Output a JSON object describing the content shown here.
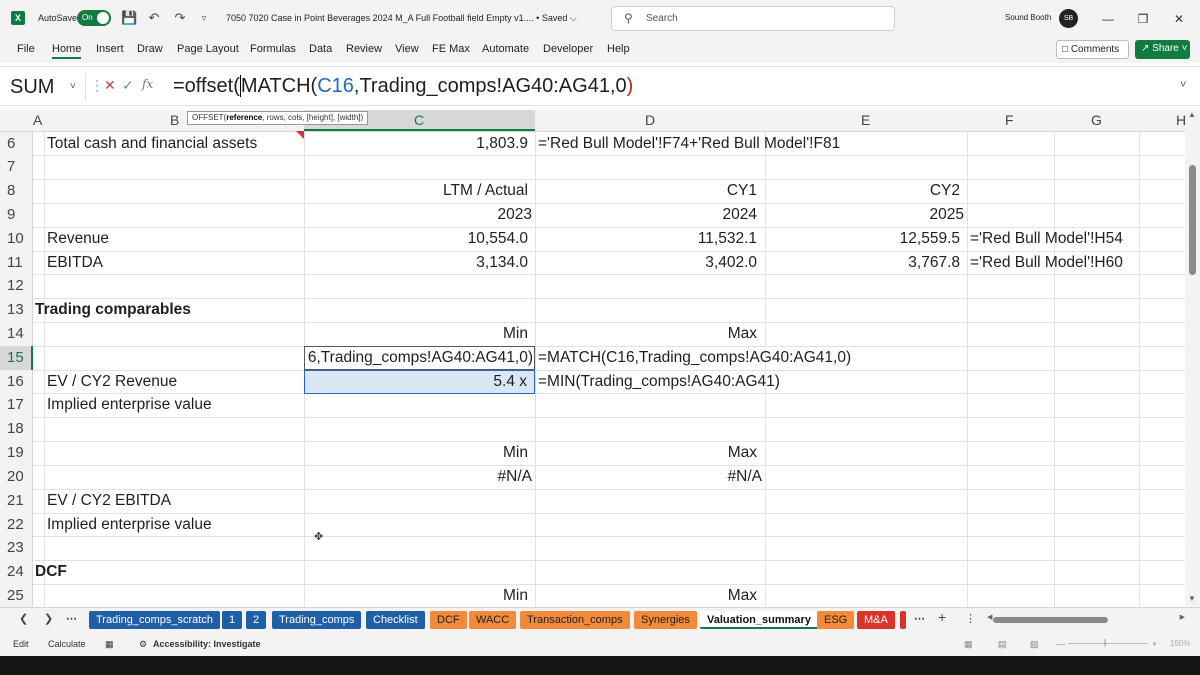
{
  "titlebar": {
    "autosave_label": "AutoSave",
    "autosave_state": "On",
    "doc_title": "7050 7020 Case in Point Beverages 2024 M_A Full Football field Empty v1.... • Saved ⌵",
    "search_placeholder": "Search",
    "user_name": "Sound Booth",
    "avatar_initials": "SB",
    "icons": [
      "excel-logo",
      "save-icon",
      "undo-icon",
      "redo-icon",
      "customize-icon",
      "search-icon",
      "minimize-icon",
      "restore-icon",
      "close-icon"
    ]
  },
  "ribbon": {
    "tabs": [
      "File",
      "Home",
      "Insert",
      "Draw",
      "Page Layout",
      "Formulas",
      "Data",
      "Review",
      "View",
      "FE Max",
      "Automate",
      "Developer",
      "Help"
    ],
    "active_tab": "Home",
    "comments_label": "Comments",
    "share_label": "Share"
  },
  "formula_bar": {
    "name_box": "SUM",
    "cancel_glyph": "✕",
    "enter_glyph": "✓",
    "fx_glyph": "fx",
    "formula_prefix": "=offset(",
    "formula_match": "MATCH(",
    "formula_ref": "C16",
    "formula_rest": ",Trading_comps!AG40:AG41,0",
    "formula_close": ")"
  },
  "tooltip": {
    "fn": "OFFSET(",
    "arg_bold": "reference",
    "args_rest": ", rows, cols, [height], [width])"
  },
  "columns": [
    "A",
    "B",
    "C",
    "D",
    "E",
    "F",
    "G",
    "H"
  ],
  "rows": [
    "6",
    "7",
    "8",
    "9",
    "10",
    "11",
    "12",
    "13",
    "14",
    "15",
    "16",
    "17",
    "18",
    "19",
    "20",
    "21",
    "22",
    "23",
    "24",
    "25"
  ],
  "cells": {
    "b6": "Total cash and financial assets",
    "c6": "1,803.9",
    "d6": "='Red Bull Model'!F74+'Red Bull Model'!F81",
    "c8": "LTM / Actual",
    "d8": "CY1",
    "e8": "CY2",
    "c9": "2023",
    "d9": "2024",
    "e9": "2025",
    "b10": "Revenue",
    "c10": "10,554.0",
    "d10": "11,532.1",
    "e10": "12,559.5",
    "f10": "='Red Bull Model'!H54",
    "b11": "EBITDA",
    "c11": "3,134.0",
    "d11": "3,402.0",
    "e11": "3,767.8",
    "f11": "='Red Bull Model'!H60",
    "a13": "Trading comparables",
    "c14": "Min",
    "d14": "Max",
    "c15_edit": "6,Trading_comps!AG40:AG41,0)",
    "d15": "=MATCH(C16,Trading_comps!AG40:AG41,0)",
    "b16": "EV / CY2 Revenue",
    "c16": "5.4 x",
    "d16": "=MIN(Trading_comps!AG40:AG41)",
    "b17": "Implied enterprise value",
    "c19": "Min",
    "d19": "Max",
    "c20": "#N/A",
    "d20": "#N/A",
    "b21": "EV / CY2 EBITDA",
    "b22": "Implied enterprise value",
    "a24": "DCF",
    "c25": "Min",
    "d25": "Max"
  },
  "sheet_tabs": [
    {
      "label": "Trading_comps_scratch",
      "style": "blue"
    },
    {
      "label": "1",
      "style": "blue"
    },
    {
      "label": "2",
      "style": "blue"
    },
    {
      "label": "Trading_comps",
      "style": "blue"
    },
    {
      "label": "Checklist",
      "style": "blue"
    },
    {
      "label": "DCF",
      "style": "orange"
    },
    {
      "label": "WACC",
      "style": "orange"
    },
    {
      "label": "Transaction_comps",
      "style": "orange"
    },
    {
      "label": "Synergies",
      "style": "orange"
    },
    {
      "label": "Valuation_summary",
      "style": "active"
    },
    {
      "label": "ESG",
      "style": "orange"
    },
    {
      "label": "M&A",
      "style": "red"
    }
  ],
  "statusbar": {
    "mode": "Edit",
    "calculate": "Calculate",
    "accessibility": "Accessibility: Investigate",
    "zoom": "150%"
  },
  "colors": {
    "excel_green": "#107c41",
    "blue_tab": "#1f5fa8",
    "orange_tab": "#f28a3a",
    "red_tab": "#d9342b",
    "ref_blue": "#2467c8"
  }
}
